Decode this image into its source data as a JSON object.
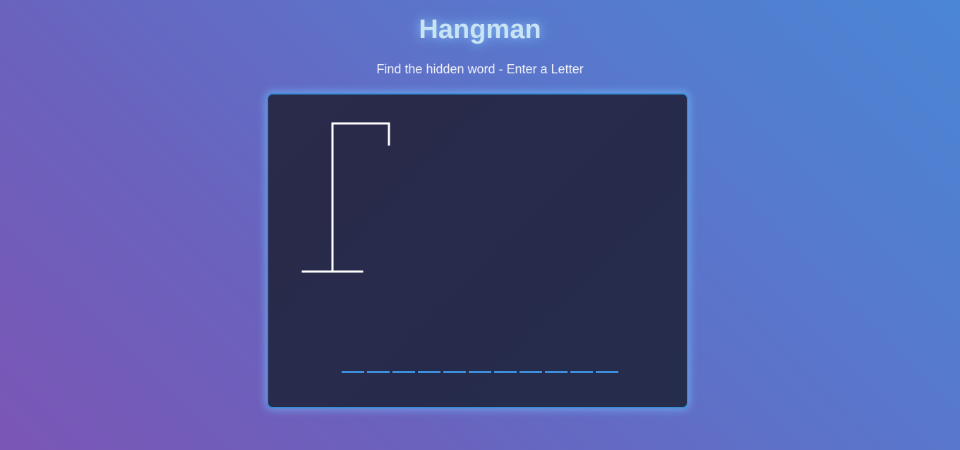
{
  "game": {
    "title": "Hangman",
    "instructions": "Find the hidden word - Enter a Letter"
  },
  "word": {
    "letter_count": 11,
    "revealed": [
      "",
      "",
      "",
      "",
      "",
      "",
      "",
      "",
      "",
      "",
      ""
    ]
  },
  "hangman": {
    "parts_drawn": [
      "base",
      "pole",
      "beam",
      "rope"
    ],
    "wrong_guesses": 0
  },
  "colors": {
    "accent": "#3d8fdd",
    "board_border": "#3a8bd6",
    "title": "#c9e4f4",
    "board_bg": "#282b4b",
    "drawing": "#ffffff"
  }
}
